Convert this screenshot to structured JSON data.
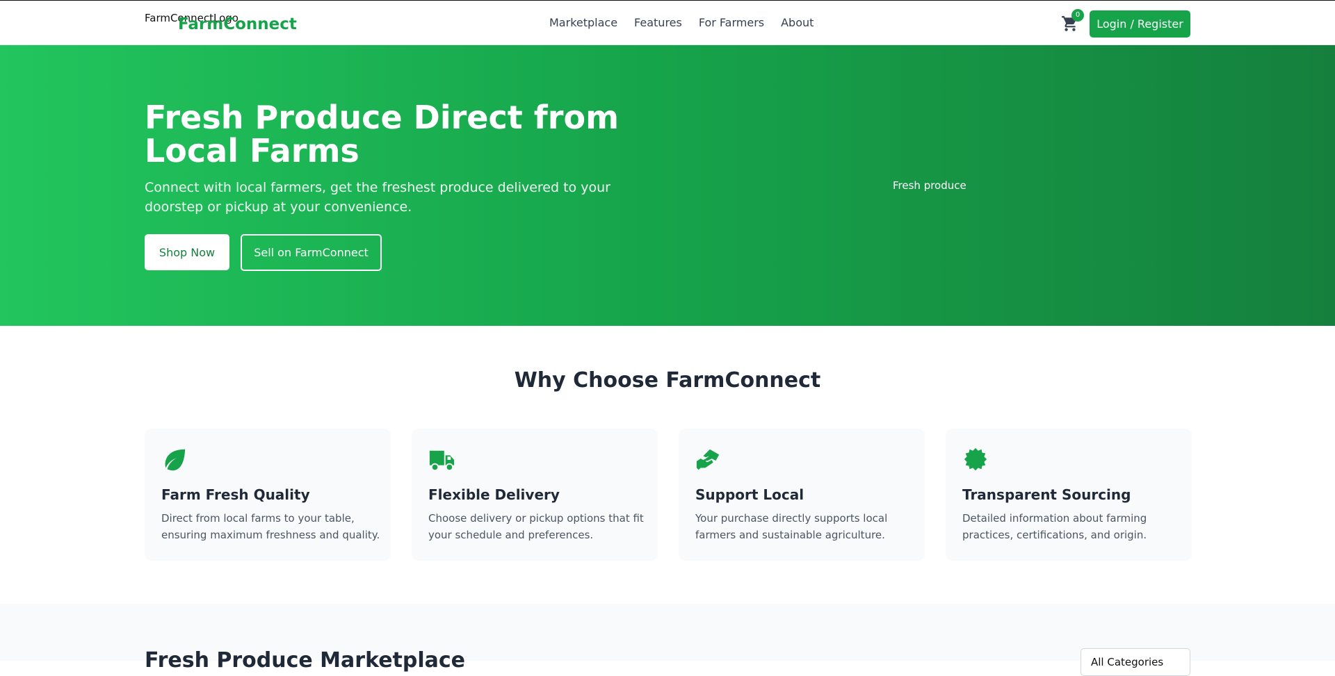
{
  "header": {
    "logo_alt": "FarmConnectLogo",
    "brand": "FarmConnect",
    "nav": [
      "Marketplace",
      "Features",
      "For Farmers",
      "About"
    ],
    "cart_count": "0",
    "login_label": "Login / Register"
  },
  "hero": {
    "title": "Fresh Produce Direct from Local Farms",
    "subtitle": "Connect with local farmers, get the freshest produce delivered to your doorstep or pickup at your convenience.",
    "shop_label": "Shop Now",
    "sell_label": "Sell on FarmConnect",
    "image_alt": "Fresh produce"
  },
  "why": {
    "title": "Why Choose FarmConnect",
    "cards": [
      {
        "icon": "leaf-icon",
        "title": "Farm Fresh Quality",
        "text": "Direct from local farms to your table, ensuring maximum freshness and quality."
      },
      {
        "icon": "truck-icon",
        "title": "Flexible Delivery",
        "text": "Choose delivery or pickup options that fit your schedule and preferences."
      },
      {
        "icon": "handshake-icon",
        "title": "Support Local",
        "text": "Your purchase directly supports local farmers and sustainable agriculture."
      },
      {
        "icon": "certificate-icon",
        "title": "Transparent Sourcing",
        "text": "Detailed information about farming practices, certifications, and origin."
      }
    ]
  },
  "marketplace": {
    "title": "Fresh Produce Marketplace",
    "category_select": "All Categories"
  },
  "colors": {
    "brand": "#16a34a",
    "hero_start": "#22c55e",
    "hero_end": "#15803d"
  }
}
